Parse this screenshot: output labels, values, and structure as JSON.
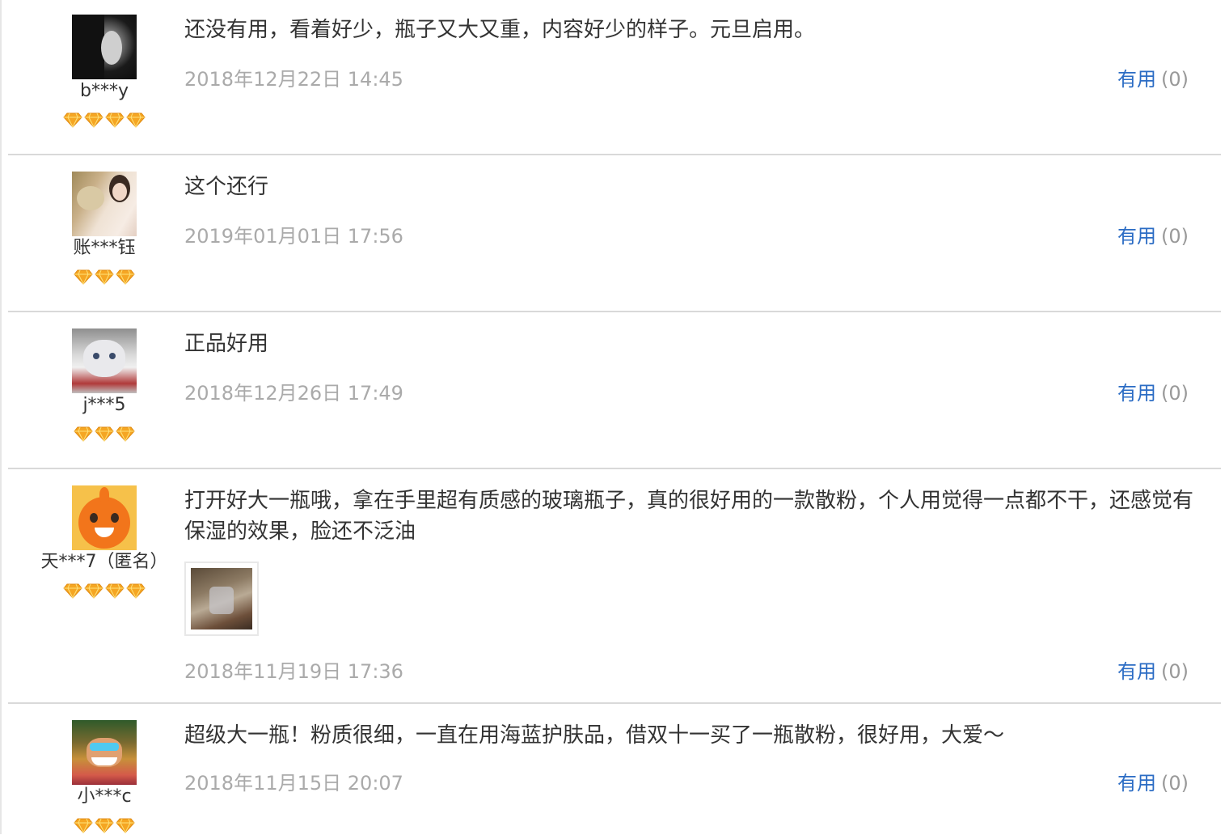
{
  "colors": {
    "link_blue": "#2b6cc4",
    "date_gray": "#aaaaaa",
    "divider": "#d9d9d9",
    "gem_orange": "#f5a623"
  },
  "reviews": [
    {
      "username": "b***y",
      "level": 4,
      "avatar": "avatar-woman-bw",
      "text": "还没有用，看着好少，瓶子又大又重，内容好少的样子。元旦启用。",
      "date": "2018年12月22日 14:45",
      "useful_label": "有用",
      "useful_count": "(0)"
    },
    {
      "username": "账***钰",
      "level": 3,
      "avatar": "avatar-girl-flowers",
      "text": "这个还行",
      "date": "2019年01月01日 17:56",
      "useful_label": "有用",
      "useful_count": "(0)"
    },
    {
      "username": "j***5",
      "level": 3,
      "avatar": "avatar-cat",
      "text": "正品好用",
      "date": "2018年12月26日 17:49",
      "useful_label": "有用",
      "useful_count": "(0)"
    },
    {
      "username": "天***7（匿名）",
      "level": 4,
      "avatar": "avatar-default-orange",
      "text": "打开好大一瓶哦，拿在手里超有质感的玻璃瓶子，真的很好用的一款散粉，个人用觉得一点都不干，还感觉有保湿的效果，脸还不泛油",
      "has_photo": true,
      "date": "2018年11月19日 17:36",
      "useful_label": "有用",
      "useful_count": "(0)"
    },
    {
      "username": "小***c",
      "level": 3,
      "avatar": "avatar-cartoon",
      "text": "超级大一瓶！粉质很细，一直在用海蓝护肤品，借双十一买了一瓶散粉，很好用，大爱～",
      "date": "2018年11月15日 20:07",
      "useful_label": "有用",
      "useful_count": "(0)"
    }
  ]
}
